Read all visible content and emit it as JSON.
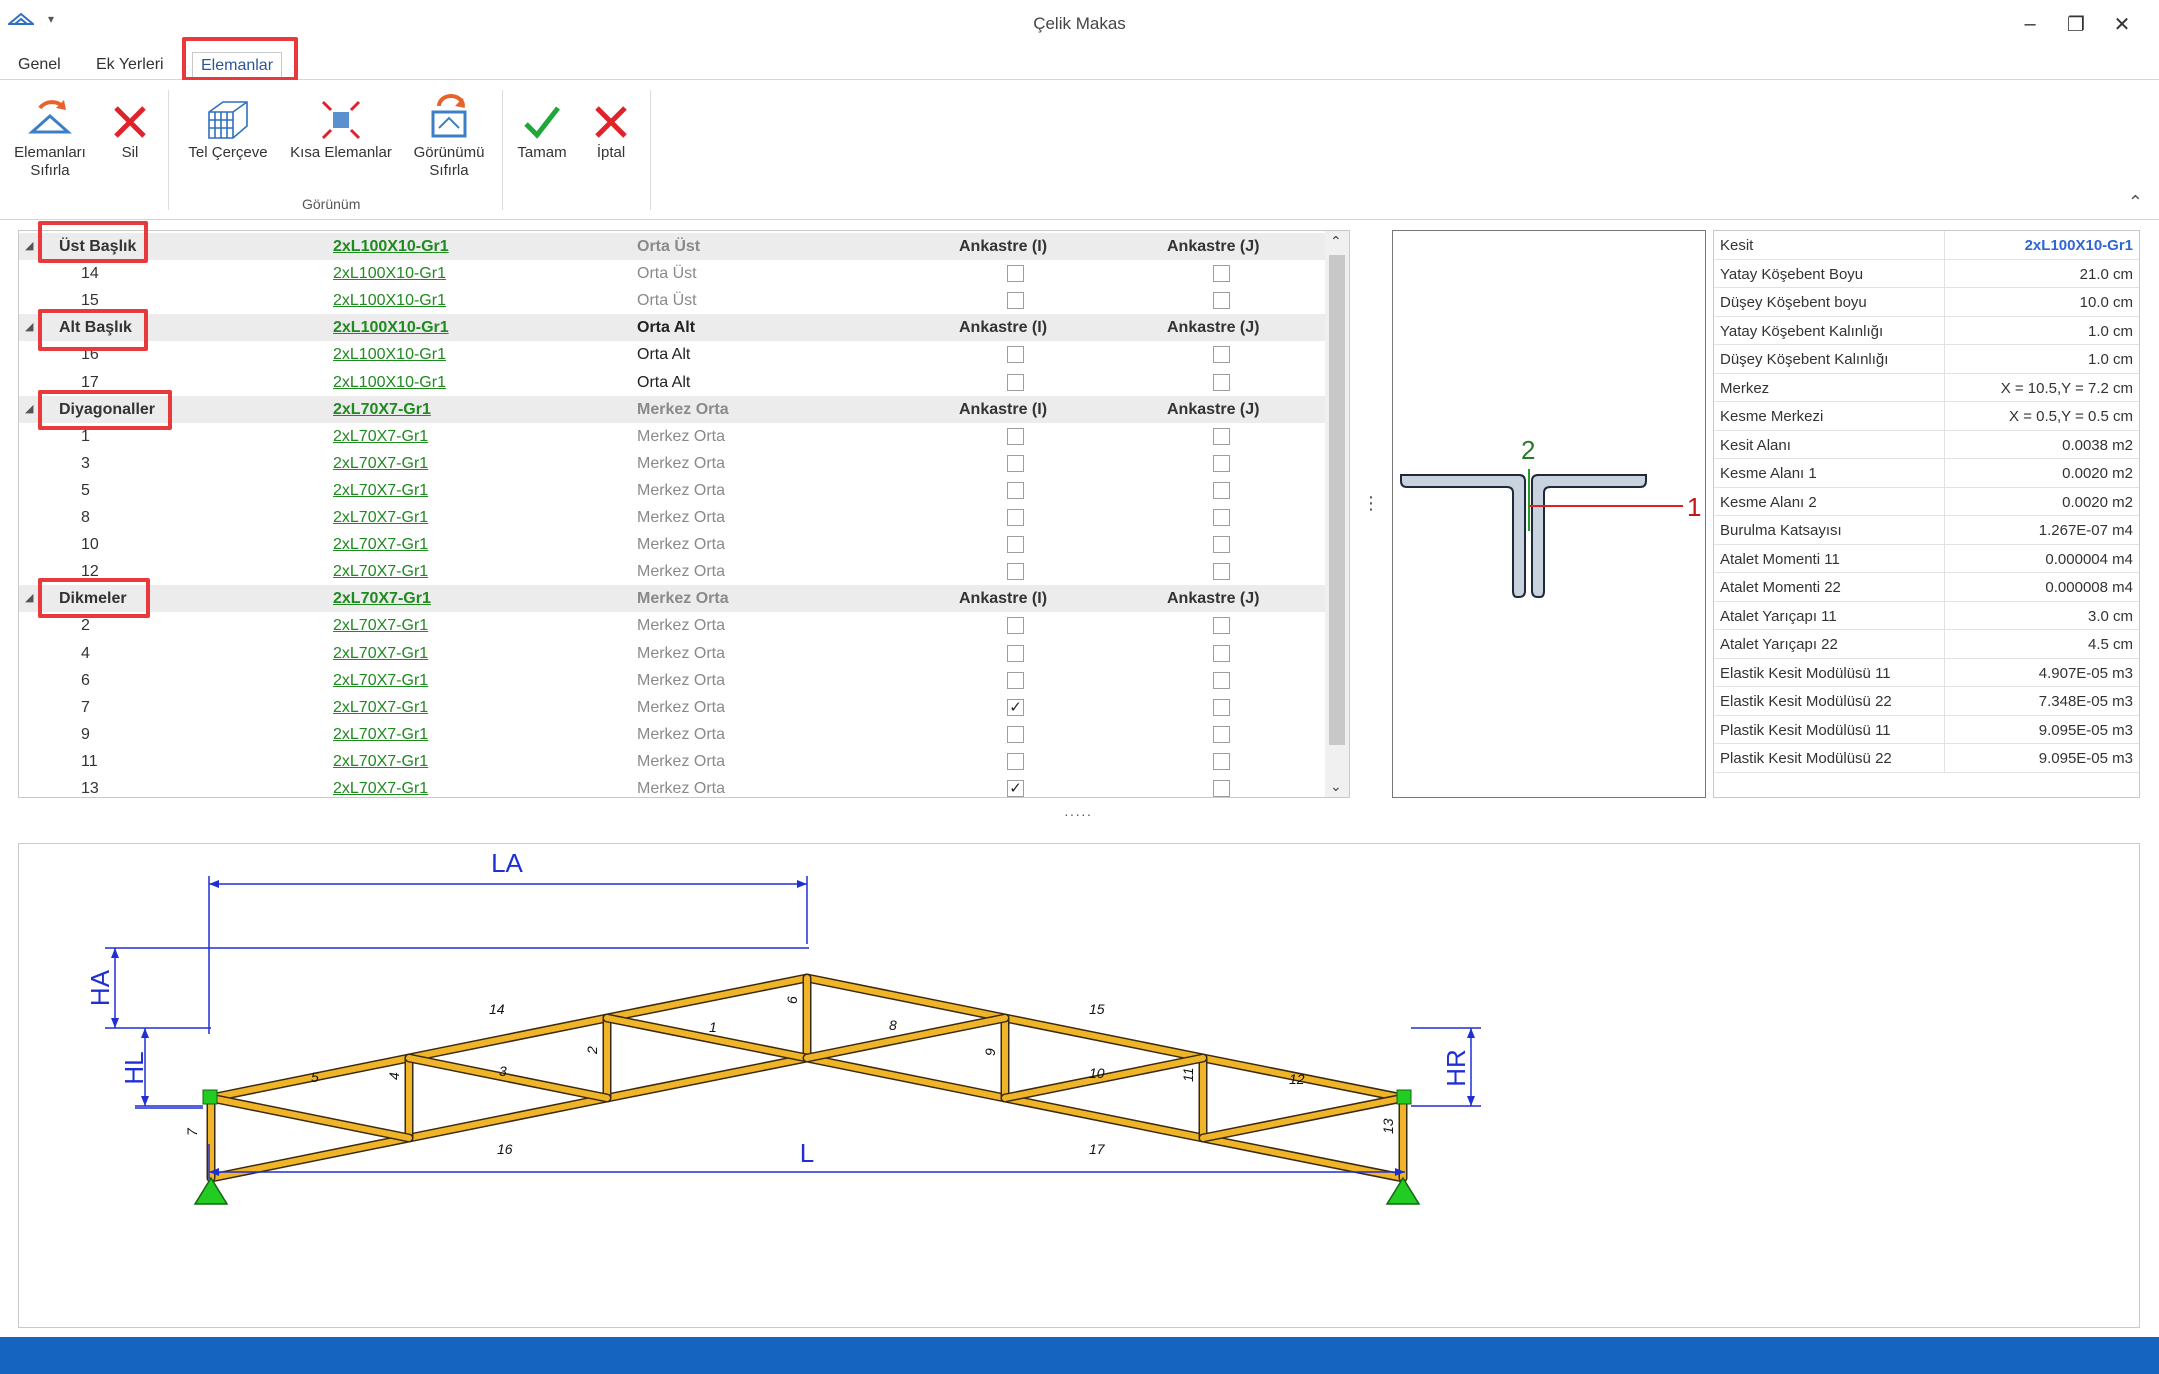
{
  "window": {
    "title": "Çelik Makas",
    "minimize": "–",
    "restore": "❐",
    "close": "✕"
  },
  "tabs": [
    {
      "label": "Genel"
    },
    {
      "label": "Ek Yerleri"
    },
    {
      "label": "Elemanlar",
      "active": true
    }
  ],
  "ribbon": {
    "reset_elements": "Elemanları\nSıfırla",
    "delete": "Sil",
    "wireframe": "Tel Çerçeve",
    "short_elements": "Kısa Elemanlar",
    "reset_view": "Görünümü\nSıfırla",
    "ok": "Tamam",
    "cancel": "İptal",
    "group_view": "Görünüm"
  },
  "grid": {
    "groups": [
      {
        "name": "Üst Başlık",
        "section": "2xL100X10-Gr1",
        "position": "Orta Üst",
        "position_dark": false,
        "fixed_i": "Ankastre (I)",
        "fixed_j": "Ankastre (J)",
        "rows": [
          {
            "id": "14",
            "section": "2xL100X10-Gr1",
            "position": "Orta Üst",
            "fi": false,
            "fj": false
          },
          {
            "id": "15",
            "section": "2xL100X10-Gr1",
            "position": "Orta Üst",
            "fi": false,
            "fj": false
          }
        ]
      },
      {
        "name": "Alt Başlık",
        "section": "2xL100X10-Gr1",
        "position": "Orta Alt",
        "position_dark": true,
        "fixed_i": "Ankastre (I)",
        "fixed_j": "Ankastre (J)",
        "rows": [
          {
            "id": "16",
            "section": "2xL100X10-Gr1",
            "position": "Orta Alt",
            "fi": false,
            "fj": false,
            "dark": true
          },
          {
            "id": "17",
            "section": "2xL100X10-Gr1",
            "position": "Orta Alt",
            "fi": false,
            "fj": false,
            "dark": true
          }
        ]
      },
      {
        "name": "Diyagonaller",
        "section": "2xL70X7-Gr1",
        "position": "Merkez Orta",
        "position_dark": false,
        "fixed_i": "Ankastre (I)",
        "fixed_j": "Ankastre (J)",
        "rows": [
          {
            "id": "1",
            "section": "2xL70X7-Gr1",
            "position": "Merkez Orta",
            "fi": false,
            "fj": false
          },
          {
            "id": "3",
            "section": "2xL70X7-Gr1",
            "position": "Merkez Orta",
            "fi": false,
            "fj": false
          },
          {
            "id": "5",
            "section": "2xL70X7-Gr1",
            "position": "Merkez Orta",
            "fi": false,
            "fj": false
          },
          {
            "id": "8",
            "section": "2xL70X7-Gr1",
            "position": "Merkez Orta",
            "fi": false,
            "fj": false
          },
          {
            "id": "10",
            "section": "2xL70X7-Gr1",
            "position": "Merkez Orta",
            "fi": false,
            "fj": false
          },
          {
            "id": "12",
            "section": "2xL70X7-Gr1",
            "position": "Merkez Orta",
            "fi": false,
            "fj": false
          }
        ]
      },
      {
        "name": "Dikmeler",
        "section": "2xL70X7-Gr1",
        "position": "Merkez Orta",
        "position_dark": false,
        "fixed_i": "Ankastre (I)",
        "fixed_j": "Ankastre (J)",
        "rows": [
          {
            "id": "2",
            "section": "2xL70X7-Gr1",
            "position": "Merkez Orta",
            "fi": false,
            "fj": false
          },
          {
            "id": "4",
            "section": "2xL70X7-Gr1",
            "position": "Merkez Orta",
            "fi": false,
            "fj": false
          },
          {
            "id": "6",
            "section": "2xL70X7-Gr1",
            "position": "Merkez Orta",
            "fi": false,
            "fj": false
          },
          {
            "id": "7",
            "section": "2xL70X7-Gr1",
            "position": "Merkez Orta",
            "fi": true,
            "fj": false
          },
          {
            "id": "9",
            "section": "2xL70X7-Gr1",
            "position": "Merkez Orta",
            "fi": false,
            "fj": false
          },
          {
            "id": "11",
            "section": "2xL70X7-Gr1",
            "position": "Merkez Orta",
            "fi": false,
            "fj": false
          },
          {
            "id": "13",
            "section": "2xL70X7-Gr1",
            "position": "Merkez Orta",
            "fi": true,
            "fj": false
          }
        ]
      }
    ]
  },
  "section_preview": {
    "axis1": "1",
    "axis2": "2"
  },
  "properties": [
    {
      "key": "Kesit",
      "value": "2xL100X10-Gr1"
    },
    {
      "key": "Yatay Köşebent Boyu",
      "value": "21.0 cm"
    },
    {
      "key": "Düşey Köşebent boyu",
      "value": "10.0 cm"
    },
    {
      "key": "Yatay Köşebent Kalınlığı",
      "value": "1.0 cm"
    },
    {
      "key": "Düşey Köşebent Kalınlığı",
      "value": "1.0 cm"
    },
    {
      "key": "Merkez",
      "value": "X = 10.5,Y = 7.2 cm"
    },
    {
      "key": "Kesme Merkezi",
      "value": "X = 0.5,Y = 0.5 cm"
    },
    {
      "key": "Kesit Alanı",
      "value": "0.0038 m2"
    },
    {
      "key": "Kesme Alanı 1",
      "value": "0.0020 m2"
    },
    {
      "key": "Kesme Alanı 2",
      "value": "0.0020 m2"
    },
    {
      "key": "Burulma Katsayısı",
      "value": "1.267E-07 m4"
    },
    {
      "key": "Atalet Momenti 11",
      "value": "0.000004 m4"
    },
    {
      "key": "Atalet Momenti 22",
      "value": "0.000008 m4"
    },
    {
      "key": "Atalet Yarıçapı 11",
      "value": "3.0 cm"
    },
    {
      "key": "Atalet Yarıçapı 22",
      "value": "4.5 cm"
    },
    {
      "key": "Elastik Kesit Modülüsü 11",
      "value": "4.907E-05 m3"
    },
    {
      "key": "Elastik Kesit Modülüsü 22",
      "value": "7.348E-05 m3"
    },
    {
      "key": "Plastik Kesit Modülüsü 11",
      "value": "9.095E-05 m3"
    },
    {
      "key": "Plastik Kesit Modülüsü 22",
      "value": "9.095E-05 m3"
    }
  ],
  "drawing": {
    "dims": {
      "LA": "LA",
      "HA": "HA",
      "HL": "HL",
      "HR": "HR",
      "L": "L"
    },
    "member_labels": [
      "14",
      "15",
      "16",
      "17",
      "1",
      "3",
      "5",
      "8",
      "10",
      "12",
      "2",
      "4",
      "6",
      "7",
      "9",
      "11",
      "13"
    ]
  },
  "colors": {
    "accent": "#2b579a",
    "highlight": "#e8393c",
    "link_green": "#1f8a1f",
    "member": "#f0b429",
    "dimension": "#1f2fd6",
    "status": "#1565c0"
  }
}
